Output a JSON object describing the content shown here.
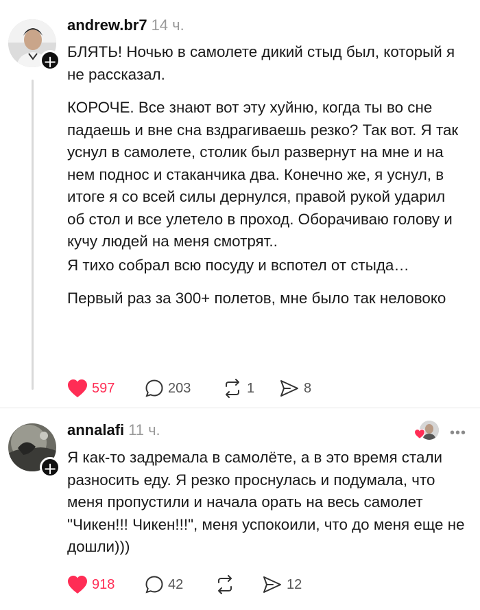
{
  "post1": {
    "username": "andrew.br7",
    "time": "14 ч.",
    "paragraphs": [
      "БЛЯТЬ! Ночью в самолете дикий стыд был, который я не рассказал.",
      "КОРОЧЕ. Все знают вот эту хуйню, когда ты во сне падаешь и вне сна вздрагиваешь резко? Так вот. Я так уснул в самолете, столик был развернут на мне и на нем поднос и стаканчика два. Конечно же, я уснул, в итоге я со всей силы дернулся, правой рукой ударил об стол и все улетело в проход. Оборачиваю голову и кучу людей на меня смотрят..",
      "Я тихо собрал всю посуду и вспотел от стыда…",
      "Первый раз за 300+ полетов, мне было так неловоко"
    ],
    "likes": "597",
    "comments": "203",
    "reposts": "1",
    "shares": "8"
  },
  "post2": {
    "username": "annalafi",
    "time": "11 ч.",
    "text": "Я как-то задремала в самолёте, а в это время стали разносить еду. Я резко проснулась и подумала, что меня пропустили и начала орать на весь самолет \"Чикен!!! Чикен!!!\", меня успокоили, что до меня еще не дошли)))",
    "likes": "918",
    "comments": "42",
    "reposts": "",
    "shares": "12",
    "more_label": "•••"
  },
  "icons": {
    "plus": "+",
    "heart": "heart-icon",
    "comment": "comment-icon",
    "repost": "repost-icon",
    "share": "share-icon"
  },
  "colors": {
    "like": "#ff2d55",
    "text": "#1a1a1a",
    "muted": "#9a9a9a"
  }
}
